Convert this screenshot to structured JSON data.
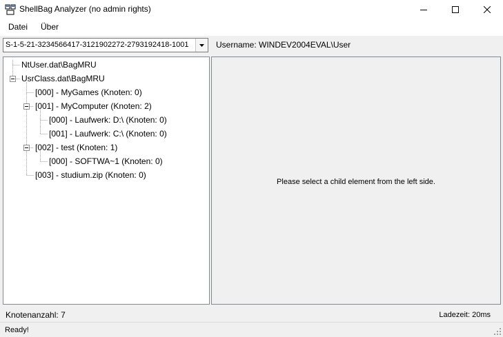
{
  "window": {
    "title": "ShellBag Analyzer (no admin rights)"
  },
  "menu": [
    {
      "label": "Datei"
    },
    {
      "label": "Über"
    }
  ],
  "sid_select": {
    "value": "S-1-5-21-3234566417-3121902272-2793192418-1001"
  },
  "username_label": "Username: WINDEV2004EVAL\\User",
  "tree": {
    "nodes": [
      {
        "label": "NtUser.dat\\BagMRU"
      },
      {
        "label": "UsrClass.dat\\BagMRU"
      },
      {
        "label": "[000] - MyGames (Knoten: 0)"
      },
      {
        "label": "[001] - MyComputer (Knoten: 2)"
      },
      {
        "label": "[000] - Laufwerk: D:\\ (Knoten: 0)"
      },
      {
        "label": "[001] - Laufwerk: C:\\ (Knoten: 0)"
      },
      {
        "label": "[002] - test (Knoten: 1)"
      },
      {
        "label": "[000] - SOFTWA~1 (Knoten: 0)"
      },
      {
        "label": "[003] - studium.zip (Knoten: 0)"
      }
    ]
  },
  "detail_message": "Please select a child element from the left side.",
  "footer": {
    "count": "Knotenanzahl: 7",
    "load_time": "Ladezeit: 20ms"
  },
  "status": "Ready!",
  "icons": {
    "app": "app-icon",
    "minimize": "minimize-icon",
    "maximize": "maximize-icon",
    "close": "close-icon",
    "dropdown": "chevron-down-icon",
    "collapse": "collapse-icon",
    "grip": "resize-grip-icon"
  }
}
